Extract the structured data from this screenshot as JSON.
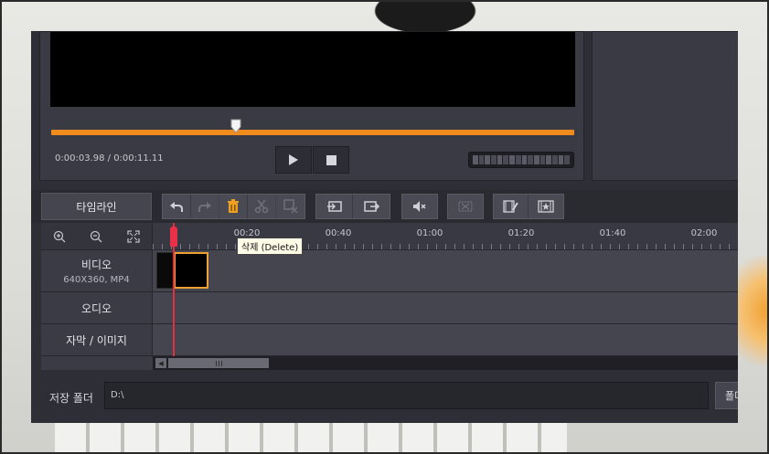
{
  "player": {
    "current_time": "0:00:03.98",
    "separator": " / ",
    "total_time": "0:00:11.11",
    "seek_progress": 0.36
  },
  "toolbar": {
    "timeline_tab": "타임라인",
    "tooltip_delete": "삭제 (Delete)"
  },
  "timeline": {
    "ruler_labels": [
      "00:20",
      "00:40",
      "01:00",
      "01:20",
      "01:40",
      "02:00"
    ],
    "tracks": {
      "video_label": "비디오",
      "video_info": "640X360, MP4",
      "audio_label": "오디오",
      "subtitle_label": "자막 / 이미지"
    }
  },
  "save": {
    "label": "저장 폴더",
    "path": "D:\\",
    "folder_button": "폴더"
  },
  "colors": {
    "accent_orange": "#f08c1e",
    "playhead_red": "#e83048",
    "panel_bg": "#2e2e36"
  }
}
